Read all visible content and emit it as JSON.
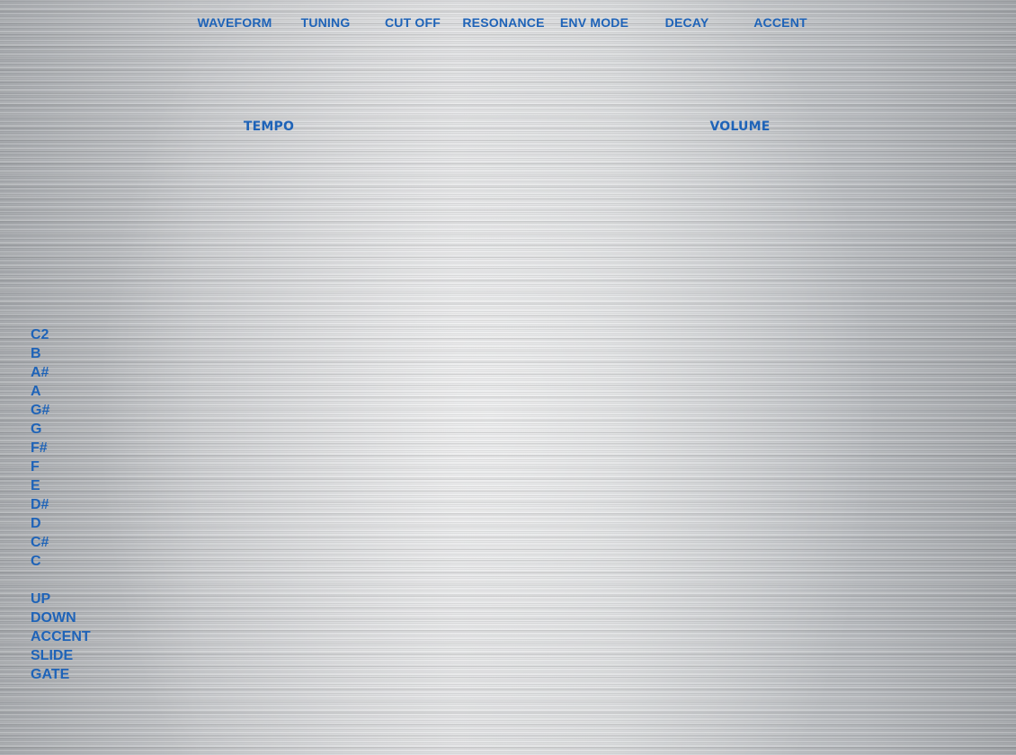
{
  "knobs_top": [
    {
      "id": "waveform",
      "label": "WAVEFORM"
    },
    {
      "id": "tuning",
      "label": "TUNING"
    },
    {
      "id": "cutoff",
      "label": "CUT OFF"
    },
    {
      "id": "resonance",
      "label": "RESONANCE"
    },
    {
      "id": "env-mode",
      "label": "ENV MODE"
    },
    {
      "id": "decay",
      "label": "DECAY"
    },
    {
      "id": "accent",
      "label": "ACCENT"
    }
  ],
  "knobs_bottom": [
    {
      "id": "tempo",
      "label": "TEMPO"
    },
    {
      "id": "volume",
      "label": "VOLUME"
    }
  ],
  "note_rows": [
    "C2",
    "B",
    "A#",
    "A",
    "G#",
    "G",
    "F#",
    "F",
    "E",
    "D#",
    "D",
    "C#",
    "C"
  ],
  "control_rows": [
    "UP",
    "DOWN",
    "ACCENT",
    "SLIDE",
    "GATE"
  ],
  "colors": {
    "label": "#1e63b8"
  }
}
